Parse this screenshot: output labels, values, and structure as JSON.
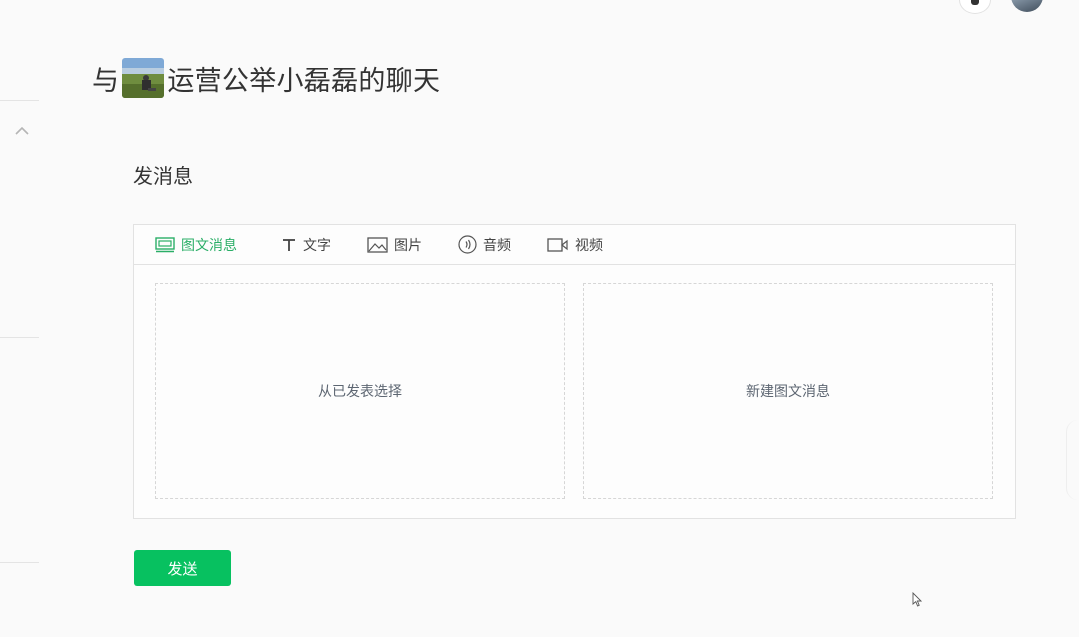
{
  "conversation": {
    "title_prefix": "与",
    "title_suffix": "运营公举小磊磊的聊天"
  },
  "compose": {
    "section_title": "发消息",
    "tabs": [
      {
        "label": "图文消息",
        "icon": "news-icon",
        "active": true
      },
      {
        "label": "文字",
        "icon": "text-icon",
        "active": false
      },
      {
        "label": "图片",
        "icon": "image-icon",
        "active": false
      },
      {
        "label": "音频",
        "icon": "audio-icon",
        "active": false
      },
      {
        "label": "视频",
        "icon": "video-icon",
        "active": false
      }
    ],
    "options": {
      "select_published": "从已发表选择",
      "create_new": "新建图文消息"
    },
    "send_label": "发送"
  },
  "colors": {
    "accent": "#07c160",
    "active_tab": "#2aae67"
  }
}
